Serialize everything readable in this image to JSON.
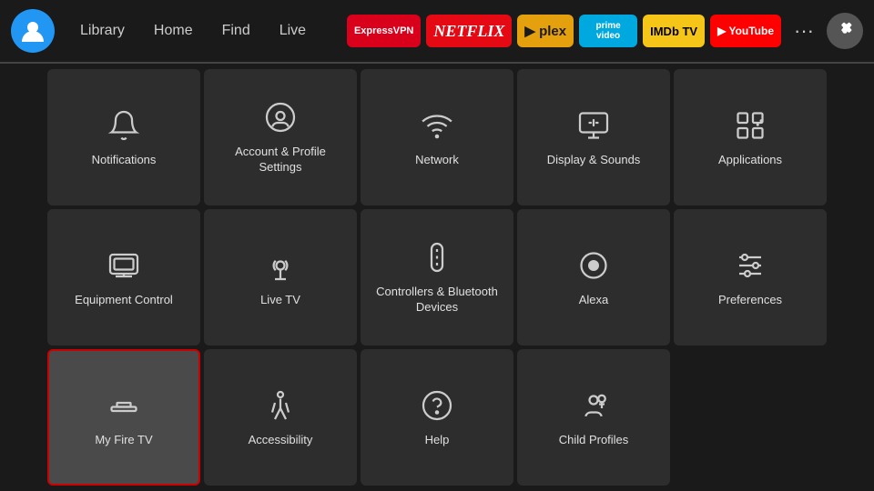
{
  "nav": {
    "links": [
      "Library",
      "Home",
      "Find",
      "Live"
    ],
    "apps": [
      {
        "label": "ExpressVPN",
        "class": "app-expressvpn"
      },
      {
        "label": "NETFLIX",
        "class": "app-netflix"
      },
      {
        "label": "plex",
        "class": "app-plex"
      },
      {
        "label": "prime video",
        "class": "app-prime"
      },
      {
        "label": "IMDb TV",
        "class": "app-imdb"
      },
      {
        "label": "▶ YouTube",
        "class": "app-youtube"
      }
    ],
    "more": "···",
    "gear": "⚙"
  },
  "settings": {
    "items": [
      {
        "id": "notifications",
        "label": "Notifications",
        "icon": "bell"
      },
      {
        "id": "account",
        "label": "Account & Profile Settings",
        "icon": "person-circle"
      },
      {
        "id": "network",
        "label": "Network",
        "icon": "wifi"
      },
      {
        "id": "display",
        "label": "Display & Sounds",
        "icon": "display"
      },
      {
        "id": "applications",
        "label": "Applications",
        "icon": "apps"
      },
      {
        "id": "equipment",
        "label": "Equipment Control",
        "icon": "monitor"
      },
      {
        "id": "livetv",
        "label": "Live TV",
        "icon": "antenna"
      },
      {
        "id": "controllers",
        "label": "Controllers & Bluetooth Devices",
        "icon": "remote"
      },
      {
        "id": "alexa",
        "label": "Alexa",
        "icon": "alexa"
      },
      {
        "id": "preferences",
        "label": "Preferences",
        "icon": "sliders"
      },
      {
        "id": "myfiretv",
        "label": "My Fire TV",
        "icon": "firetv",
        "selected": true
      },
      {
        "id": "accessibility",
        "label": "Accessibility",
        "icon": "accessibility"
      },
      {
        "id": "help",
        "label": "Help",
        "icon": "help"
      },
      {
        "id": "childprofiles",
        "label": "Child Profiles",
        "icon": "child"
      }
    ]
  }
}
